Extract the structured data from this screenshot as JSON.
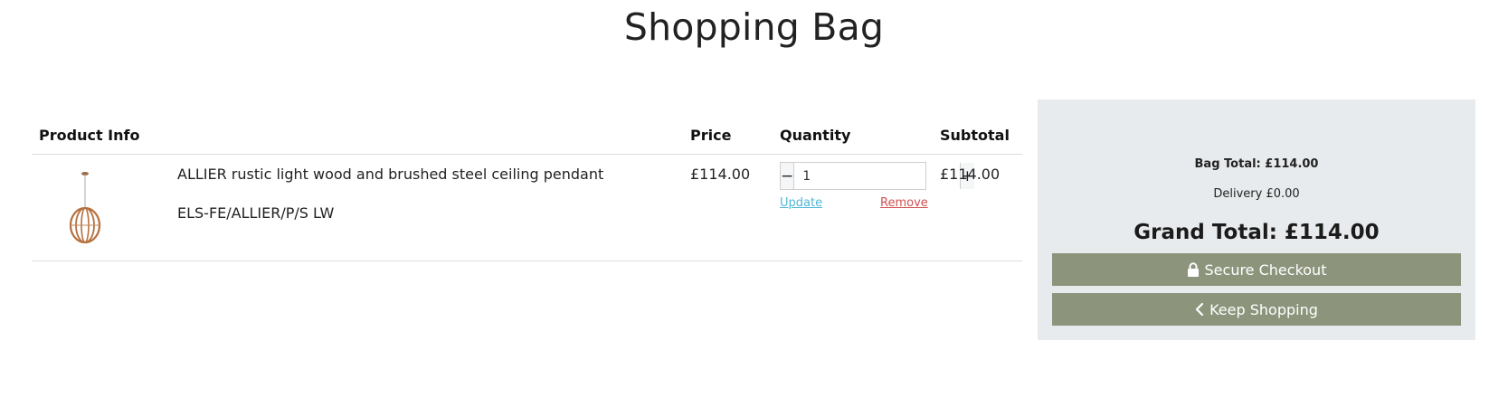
{
  "page": {
    "title": "Shopping Bag"
  },
  "table": {
    "headers": {
      "product_info": "Product Info",
      "price": "Price",
      "quantity": "Quantity",
      "subtotal": "Subtotal"
    },
    "rows": [
      {
        "name": "ALLIER rustic light wood and brushed steel ceiling pendant",
        "sku": "ELS-FE/ALLIER/P/S LW",
        "price": "£114.00",
        "quantity": "1",
        "subtotal": "£114.00",
        "update_label": "Update",
        "remove_label": "Remove",
        "minus_label": "−",
        "plus_label": "+"
      }
    ]
  },
  "summary": {
    "bag_total": "Bag Total: £114.00",
    "delivery": "Delivery £0.00",
    "grand_total": "Grand Total: £114.00",
    "checkout_label": "Secure Checkout",
    "keep_shopping_label": "Keep Shopping"
  },
  "icons": {
    "checkout": "lock-icon",
    "keep_shopping": "chevron-left-icon"
  },
  "colors": {
    "button_bg": "#8c957c",
    "panel_bg": "#e8ebed",
    "update_link": "#4fb7d6",
    "remove_link": "#d0504f"
  }
}
